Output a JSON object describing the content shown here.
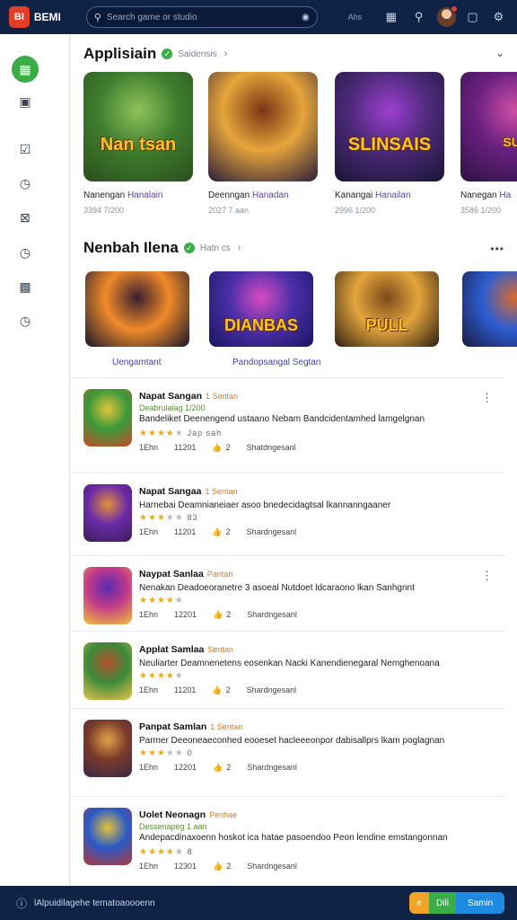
{
  "topbar": {
    "logo_text": "BI",
    "brand": "BEMI",
    "search_placeholder": "Search game or studio",
    "nav_label": "Ahs"
  },
  "sidebar": {
    "items": [
      {
        "icon": "store-icon",
        "active": true
      },
      {
        "icon": "library-icon"
      },
      {
        "icon": "tasks-icon"
      },
      {
        "icon": "chart-icon"
      },
      {
        "icon": "filter-icon"
      },
      {
        "icon": "timer-icon"
      },
      {
        "icon": "card-icon"
      },
      {
        "icon": "clock-icon"
      }
    ]
  },
  "section1": {
    "title": "Applisiain",
    "subtitle": "Saidensis",
    "cards": [
      {
        "name": "Nanengan",
        "name_hl": "Hanalain",
        "meta": "3394 7/200",
        "art": "Nan tsan",
        "palette": [
          "#3f7d2f",
          "#8fc35a",
          "#2a4f1c"
        ]
      },
      {
        "name": "Deenngan",
        "name_hl": "Hanadan",
        "meta": "2027 7 aan",
        "art": "",
        "palette": [
          "#e6a53a",
          "#7a3416",
          "#2a1d3a"
        ]
      },
      {
        "name": "Kanangai",
        "name_hl": "Hanailan",
        "meta": "2996 1/200",
        "art": "SLINSAIS",
        "palette": [
          "#4b2a78",
          "#9d3fd1",
          "#1b1536"
        ]
      },
      {
        "name": "Nanegan",
        "name_hl": "Ha",
        "meta": "3586 1/200",
        "art": "SUII",
        "palette": [
          "#6a2080",
          "#d04fa6",
          "#2b1240"
        ]
      }
    ]
  },
  "section2": {
    "title": "Nenbah Ilena",
    "subtitle": "Hatn cs",
    "tiles": [
      {
        "caption": "Uengamtant",
        "art": "",
        "palette": [
          "#f08a2a",
          "#3a1f2f",
          "#15152a"
        ]
      },
      {
        "caption": "Pandopsangal Segtan",
        "art": "DIANBAS",
        "palette": [
          "#4a2fa8",
          "#d84bc2",
          "#1a1560"
        ]
      },
      {
        "caption": "",
        "art": "PULL",
        "palette": [
          "#e3a53c",
          "#7b4b1c",
          "#2c1e12"
        ]
      },
      {
        "caption": "",
        "art": "",
        "palette": [
          "#2c5dd1",
          "#d86a2f",
          "#1a1a40"
        ]
      }
    ]
  },
  "list": [
    {
      "title": "Napat Sangan",
      "tag": "1 Sentan",
      "subtitle": "Deabrulaiag 1/200",
      "desc": "Bandeliket Deenengend ustaano Nebam Bandcidentamhed lamgelgnan",
      "rating": 4,
      "rating_text": "Jap sah",
      "f1": "1Ehn",
      "f2": "11201",
      "f3": "2",
      "f4": "Shatdngesanl",
      "palette": [
        "#3a9a3a",
        "#e4c23a",
        "#c54b2a"
      ]
    },
    {
      "title": "Napat Sangaa",
      "tag": "1 Sentan",
      "subtitle": "",
      "desc": "Harnebai Deamnianeiaer asoo bnedecidagtsal lkannanngaaner",
      "rating": 3,
      "rating_text": "83",
      "f1": "1Ehn",
      "f2": "11201",
      "f3": "2",
      "f4": "Shardngesanl",
      "palette": [
        "#6a2aa8",
        "#e3923a",
        "#3b1f5a"
      ]
    },
    {
      "title": "Naypat Sanlaa",
      "tag": "Pantan",
      "subtitle": "",
      "desc": "Nenakan Deadoeoranetre 3 asoeal Nutdoet ldcaraono lkan Sanhgnnt",
      "rating": 4,
      "rating_text": "",
      "f1": "1Ehn",
      "f2": "12201",
      "f3": "2",
      "f4": "Shardngesanl",
      "palette": [
        "#c23a8a",
        "#5a2ab0",
        "#f2c23a"
      ]
    },
    {
      "title": "Applat Samlaa",
      "tag": "Sentan",
      "subtitle": "",
      "desc": "Neuliarter Deamnenetens eosenkan Nacki Kanendienegaral Nemghenoana",
      "rating": 4,
      "rating_text": "",
      "f1": "1Ehn",
      "f2": "11201",
      "f3": "2",
      "f4": "Shardngesanl",
      "palette": [
        "#3a8a3a",
        "#b4502a",
        "#e6c24a"
      ]
    },
    {
      "title": "Panpat Samlan",
      "tag": "1 Sentan",
      "subtitle": "",
      "desc": "Parmer Deeoneaeconhed eooeset hacleeeonpor dabisallprs lkam poglagnan",
      "rating": 3,
      "rating_text": "0",
      "f1": "1Ehn",
      "f2": "12201",
      "f3": "2",
      "f4": "Shardngesanl",
      "palette": [
        "#7a3a2a",
        "#e0a24a",
        "#3a2a4a"
      ]
    },
    {
      "title": "Uolet Neonagn",
      "tag": "Penhae",
      "subtitle": "Dessenapeg 1 aan",
      "desc": "Andepacdinaxoenn hoskot ica hatae pasoendoo Peon lendine emstangonnan",
      "rating": 4,
      "rating_text": "8",
      "f1": "1Ehn",
      "f2": "12301",
      "f3": "2",
      "f4": "Shardngesanl",
      "palette": [
        "#2a5ac8",
        "#e4c23a",
        "#b03a3a"
      ]
    }
  ],
  "footer": {
    "text": "lAlpuidilagehe tematoaoooenn",
    "btn_a": "e",
    "btn_b": "Dili",
    "btn_c": "Samin"
  }
}
